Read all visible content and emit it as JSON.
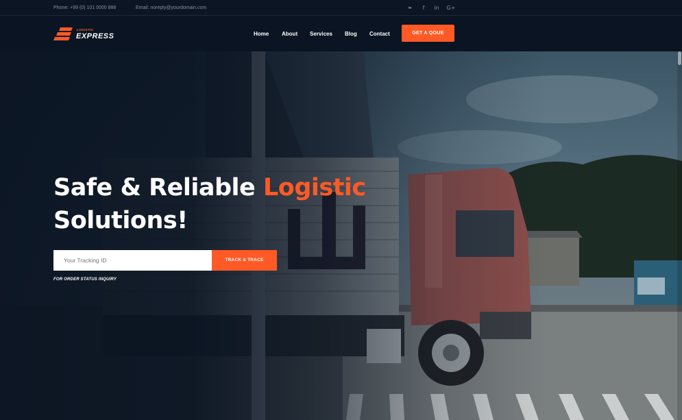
{
  "topbar": {
    "phone": "Phone: +99 (0) 101 0000 888",
    "email": "Email: noreply@yourdomain.com",
    "social": [
      {
        "icon": "twitter-icon",
        "glyph": "❧"
      },
      {
        "icon": "facebook-icon",
        "glyph": "f"
      },
      {
        "icon": "linkedin-icon",
        "glyph": "in"
      },
      {
        "icon": "google-plus-icon",
        "glyph": "G+"
      }
    ]
  },
  "brand": {
    "small": "LOGISTIC",
    "big": "EXPRESS",
    "accent": "#ff5a26"
  },
  "nav": {
    "items": [
      "Home",
      "About",
      "Services",
      "Blog",
      "Contact"
    ],
    "cta": "GET A QOUE"
  },
  "hero": {
    "headline_part1": "Safe & Reliable ",
    "headline_accent": "Logistic",
    "headline_part2": "Solutions!",
    "tracking_placeholder": "Your Tracking ID",
    "track_button": "TRACK & TRACE",
    "hint": "FOR ORDER STATUS INQUIRY"
  },
  "colors": {
    "accent": "#ff5a26",
    "nav_bg": "#0a1422",
    "topbar_bg": "#0b1524"
  }
}
